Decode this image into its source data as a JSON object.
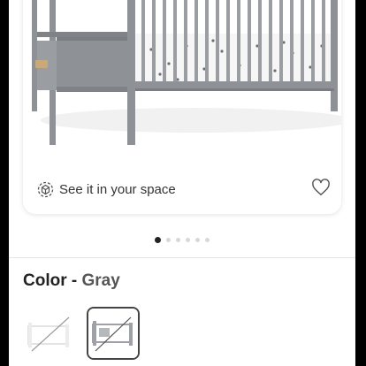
{
  "product": {
    "see_in_space_label": "See it in your space",
    "carousel": {
      "total": 6,
      "active": 0
    }
  },
  "color_selector": {
    "label": "Color",
    "separator": "-",
    "selected_value": "Gray",
    "swatches": [
      {
        "name": "White",
        "selected": false,
        "available": false
      },
      {
        "name": "Gray",
        "selected": true,
        "available": false
      }
    ]
  },
  "colors": {
    "crib_gray": "#8e9297",
    "heading_text": "#222222",
    "value_text": "#555555",
    "active_dot": "#222222",
    "inactive_dot": "#d8d8d8"
  },
  "icons": [
    "ar-view-icon",
    "heart-icon"
  ]
}
